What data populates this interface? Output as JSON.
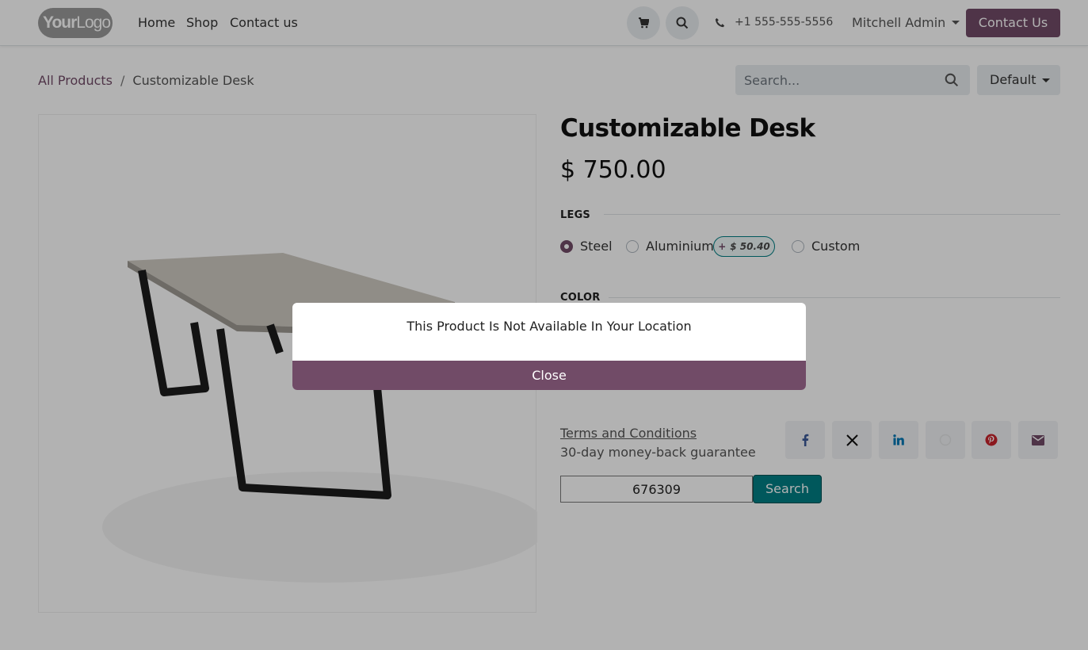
{
  "header": {
    "logo": {
      "bold": "Your",
      "light": "Logo"
    },
    "nav": [
      "Home",
      "Shop",
      "Contact us"
    ],
    "phone": "+1 555-555-5556",
    "user": "Mitchell Admin",
    "contact_button": "Contact Us"
  },
  "breadcrumb": {
    "root": "All Products",
    "separator": "/",
    "current": "Customizable Desk"
  },
  "search": {
    "placeholder": "Search..."
  },
  "sort": {
    "label": "Default"
  },
  "product": {
    "title": "Customizable Desk",
    "price": "$ 750.00",
    "legs": {
      "label": "LEGS",
      "options": [
        "Steel",
        "Aluminium",
        "Custom"
      ],
      "selected": "Steel",
      "extra_sign": "+",
      "extra_price": "$ 50.40"
    },
    "color": {
      "label": "COLOR"
    },
    "terms": "Terms and Conditions",
    "guarantee": "30-day money-back guarantee",
    "share_icons": [
      "facebook-icon",
      "x-icon",
      "linkedin-icon",
      "whatsapp-icon",
      "pinterest-icon",
      "email-icon"
    ]
  },
  "zip": {
    "value": "676309",
    "button": "Search"
  },
  "modal": {
    "message": "This Product Is Not Available In Your Location",
    "close": "Close"
  },
  "colors": {
    "primary": "#714b67",
    "secondary": "#017e84"
  }
}
